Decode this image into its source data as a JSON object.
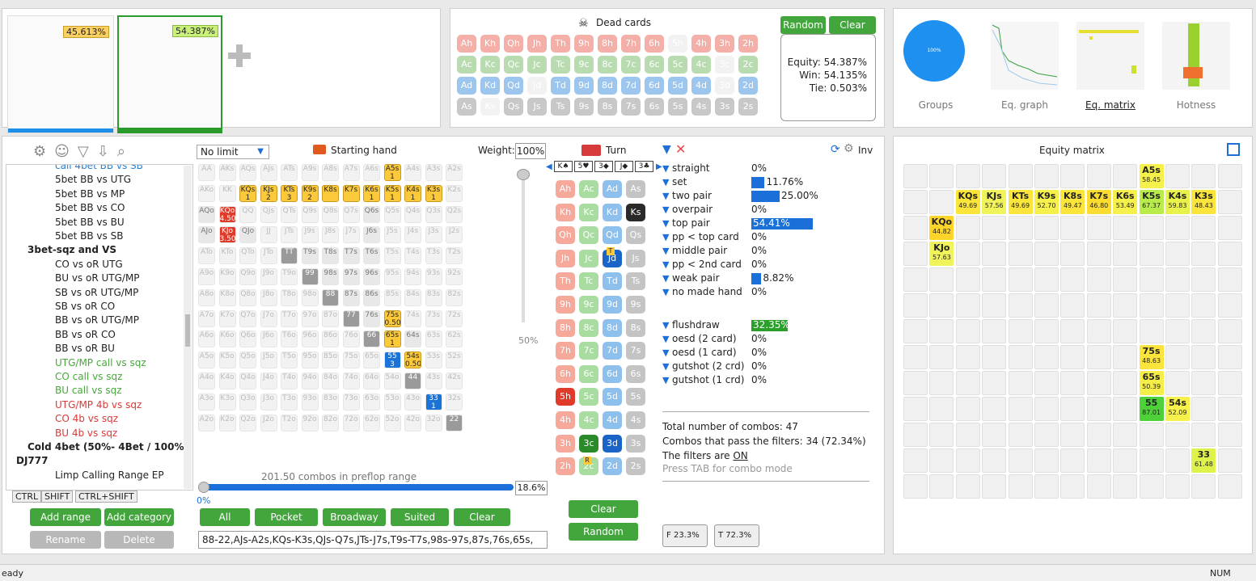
{
  "top": {
    "equity1": "45.613%",
    "equity2": "54.387%"
  },
  "dead": {
    "title": "Dead cards",
    "random": "Random",
    "clear": "Clear",
    "rows": [
      [
        "Ah",
        "Kh",
        "Qh",
        "Jh",
        "Th",
        "9h",
        "8h",
        "7h",
        "6h",
        "5h",
        "4h",
        "3h",
        "2h"
      ],
      [
        "Ac",
        "Kc",
        "Qc",
        "Jc",
        "Tc",
        "9c",
        "8c",
        "7c",
        "6c",
        "5c",
        "4c",
        "3c",
        "2c"
      ],
      [
        "Ad",
        "Kd",
        "Qd",
        "Jd",
        "Td",
        "9d",
        "8d",
        "7d",
        "6d",
        "5d",
        "4d",
        "3d",
        "2d"
      ],
      [
        "As",
        "Ks",
        "Qs",
        "Js",
        "Ts",
        "9s",
        "8s",
        "7s",
        "6s",
        "5s",
        "4s",
        "3s",
        "2s"
      ]
    ],
    "equity": "Equity: 54.387%",
    "win": "Win: 54.135%",
    "tie": "Tie: 0.503%"
  },
  "thumbs": {
    "groups": "Groups",
    "graph": "Eq. graph",
    "matrix": "Eq. matrix",
    "hotness": "Hotness",
    "pie_label": "100%"
  },
  "tree": {
    "items": [
      {
        "t": "call 4bet BB vs SB",
        "c": "#2a7fcf"
      },
      {
        "t": "5bet BB vs UTG",
        "c": "#222"
      },
      {
        "t": "5bet BB vs MP",
        "c": "#222"
      },
      {
        "t": "5bet BB vs CO",
        "c": "#222"
      },
      {
        "t": "5bet BB vs BU",
        "c": "#222"
      },
      {
        "t": "5bet BB vs SB",
        "c": "#222"
      },
      {
        "t": "3bet-sqz and VS",
        "c": "#222"
      },
      {
        "t": "CO vs oR UTG",
        "c": "#222"
      },
      {
        "t": "BU vs oR UTG/MP",
        "c": "#222"
      },
      {
        "t": "SB vs oR UTG/MP",
        "c": "#222"
      },
      {
        "t": "SB vs oR CO",
        "c": "#222"
      },
      {
        "t": "BB vs oR UTG/MP",
        "c": "#222"
      },
      {
        "t": "BB vs oR CO",
        "c": "#222"
      },
      {
        "t": "BB vs oR BU",
        "c": "#222"
      },
      {
        "t": "UTG/MP call vs sqz",
        "c": "#46a93a"
      },
      {
        "t": "CO call vs sqz",
        "c": "#46a93a"
      },
      {
        "t": "BU call vs sqz",
        "c": "#46a93a"
      },
      {
        "t": "UTG/MP 4b vs sqz",
        "c": "#d83a3a"
      },
      {
        "t": "CO 4b vs sqz",
        "c": "#d83a3a"
      },
      {
        "t": "BU 4b vs sqz",
        "c": "#d83a3a"
      },
      {
        "t": "Cold 4bet (50%- 4Bet / 100%",
        "c": "#222"
      },
      {
        "t": "DJ777",
        "c": "#222"
      },
      {
        "t": "Limp Calling Range EP",
        "c": "#222"
      }
    ],
    "ctrl": "CTRL",
    "shift": "SHIFT",
    "ctrlshift": "CTRL+SHIFT",
    "add_range": "Add range",
    "add_category": "Add category",
    "rename": "Rename",
    "delete": "Delete"
  },
  "range": {
    "limit": "No limit",
    "starting_hand": "Starting hand",
    "weight_label": "Weight:",
    "weight": "100%",
    "combos": "201.50 combos in preflop range",
    "pct": "18.6%",
    "slider_min": "0%",
    "slider_side": "50%",
    "buttons": [
      "All",
      "Pocket",
      "Broadway",
      "Suited",
      "Clear"
    ],
    "text": "88-22,AJs-A2s,KQs-K3s,QJs-Q7s,JTs-J7s,T9s-T7s,98s-97s,87s,76s,65s,",
    "kqo": "4.50",
    "kjo": "3.50",
    "kqs": "3",
    "qs75": "0.50",
    "qs54": "0.50",
    "p55": "3",
    "p33": "1",
    "r1": "1",
    "r2": "2",
    "hearts_n": "1"
  },
  "board": {
    "title": "Turn",
    "clear": "Clear",
    "random": "Random",
    "slots": [
      "K♠",
      "5♥",
      "3◆",
      "J◆",
      "3♣"
    ],
    "rows": [
      [
        "Ah",
        "Ac",
        "Ad",
        "As"
      ],
      [
        "Kh",
        "Kc",
        "Kd",
        "Ks"
      ],
      [
        "Qh",
        "Qc",
        "Qd",
        "Qs"
      ],
      [
        "Jh",
        "Jc",
        "Jd",
        "Js"
      ],
      [
        "Th",
        "Tc",
        "Td",
        "Ts"
      ],
      [
        "9h",
        "9c",
        "9d",
        "9s"
      ],
      [
        "8h",
        "8c",
        "8d",
        "8s"
      ],
      [
        "7h",
        "7c",
        "7d",
        "7s"
      ],
      [
        "6h",
        "6c",
        "6d",
        "6s"
      ],
      [
        "5h",
        "5c",
        "5d",
        "5s"
      ],
      [
        "4h",
        "4c",
        "4d",
        "4s"
      ],
      [
        "3h",
        "3c",
        "3d",
        "3s"
      ],
      [
        "2h",
        "2c",
        "2d",
        "2s"
      ]
    ],
    "tag_t": "T",
    "tag_r": "R"
  },
  "stats": {
    "inv": "Inv",
    "items": [
      {
        "n": "straight",
        "v": "0%",
        "f": 0
      },
      {
        "n": "set",
        "v": "11.76%",
        "f": 0.1176
      },
      {
        "n": "two pair",
        "v": "25.00%",
        "f": 0.25
      },
      {
        "n": "overpair",
        "v": "0%",
        "f": 0
      },
      {
        "n": "top pair",
        "v": "54.41%",
        "f": 0.5441
      },
      {
        "n": "pp < top card",
        "v": "0%",
        "f": 0
      },
      {
        "n": "middle pair",
        "v": "0%",
        "f": 0
      },
      {
        "n": "pp < 2nd card",
        "v": "0%",
        "f": 0
      },
      {
        "n": "weak pair",
        "v": "8.82%",
        "f": 0.0882
      },
      {
        "n": "no made hand",
        "v": "0%",
        "f": 0
      },
      {
        "n": "flushdraw",
        "v": "32.35%",
        "f": 0.3235
      },
      {
        "n": "oesd (2 card)",
        "v": "0%",
        "f": 0
      },
      {
        "n": "oesd (1 card)",
        "v": "0%",
        "f": 0
      },
      {
        "n": "gutshot (2 crd)",
        "v": "0%",
        "f": 0
      },
      {
        "n": "gutshot (1 crd)",
        "v": "0%",
        "f": 0
      }
    ],
    "total": "Total number of combos: 47",
    "pass": "Combos that pass the filters: 34 (72.34%)",
    "filters": "The filters are ",
    "on": "ON",
    "tab": "Press TAB for combo mode",
    "f_label": "F",
    "f_val": "23.3%",
    "t_label": "T",
    "t_val": "72.3%"
  },
  "eqmatrix": {
    "title": "Equity matrix",
    "cells": [
      {
        "h": "A5s",
        "v": "58.45",
        "r": 0,
        "c": 9,
        "col": "#f6f04a"
      },
      {
        "h": "KQs",
        "v": "49.69",
        "r": 1,
        "c": 2,
        "col": "#fbe53a"
      },
      {
        "h": "KJs",
        "v": "57.56",
        "r": 1,
        "c": 3,
        "col": "#f1f35a"
      },
      {
        "h": "KTs",
        "v": "49.69",
        "r": 1,
        "c": 4,
        "col": "#fbe53a"
      },
      {
        "h": "K9s",
        "v": "52.70",
        "r": 1,
        "c": 5,
        "col": "#f6f04a"
      },
      {
        "h": "K8s",
        "v": "49.47",
        "r": 1,
        "c": 6,
        "col": "#fbe53a"
      },
      {
        "h": "K7s",
        "v": "46.80",
        "r": 1,
        "c": 7,
        "col": "#fddc30"
      },
      {
        "h": "K6s",
        "v": "53.49",
        "r": 1,
        "c": 8,
        "col": "#f6f04a"
      },
      {
        "h": "K5s",
        "v": "67.37",
        "r": 1,
        "c": 9,
        "col": "#b8ec4a"
      },
      {
        "h": "K4s",
        "v": "59.83",
        "r": 1,
        "c": 10,
        "col": "#e8f24a"
      },
      {
        "h": "K3s",
        "v": "48.43",
        "r": 1,
        "c": 11,
        "col": "#fbe53a"
      },
      {
        "h": "KQo",
        "v": "44.82",
        "r": 2,
        "c": 1,
        "col": "#fdd42a"
      },
      {
        "h": "KJo",
        "v": "57.63",
        "r": 3,
        "c": 1,
        "col": "#f1f35a"
      },
      {
        "h": "75s",
        "v": "48.63",
        "r": 7,
        "c": 9,
        "col": "#fbe53a"
      },
      {
        "h": "65s",
        "v": "50.39",
        "r": 8,
        "c": 9,
        "col": "#f6ee48"
      },
      {
        "h": "55",
        "v": "87.01",
        "r": 9,
        "c": 9,
        "col": "#4ed038"
      },
      {
        "h": "54s",
        "v": "52.09",
        "r": 9,
        "c": 10,
        "col": "#f6f04a"
      },
      {
        "h": "33",
        "v": "61.48",
        "r": 11,
        "c": 11,
        "col": "#def24a"
      }
    ]
  },
  "status": {
    "left": "eady",
    "right": "NUM"
  }
}
